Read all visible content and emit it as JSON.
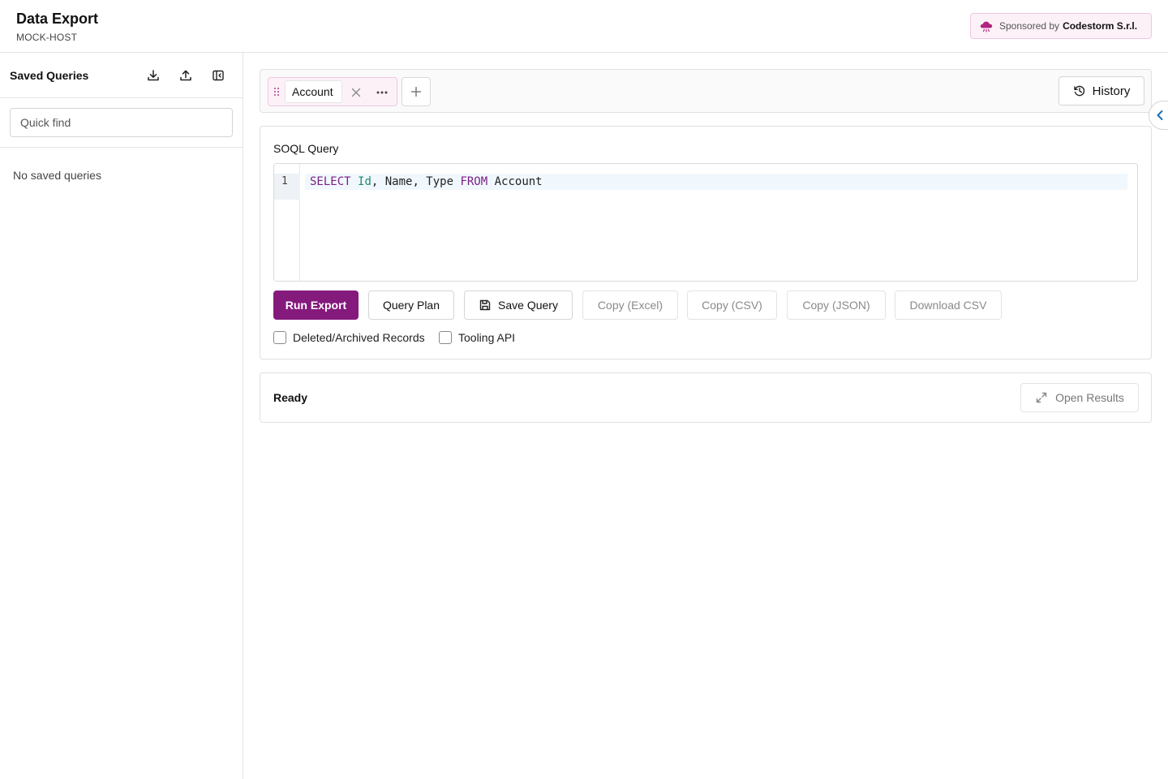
{
  "header": {
    "title": "Data Export",
    "host": "MOCK-HOST",
    "sponsor_prefix": "Sponsored by",
    "sponsor_name": "Codestorm S.r.l.",
    "sponsor_icon": "cloud-icon"
  },
  "sidebar": {
    "title": "Saved Queries",
    "icons": [
      "download-icon",
      "upload-icon",
      "collapse-sidebar-icon"
    ],
    "search_placeholder": "Quick find",
    "empty_text": "No saved queries"
  },
  "tabs": {
    "items": [
      {
        "label": "Account",
        "active": true
      }
    ],
    "history_label": "History"
  },
  "query": {
    "section_title": "SOQL Query",
    "line_number": "1",
    "code": {
      "select": "SELECT",
      "field_id": "Id",
      "rest": ", Name, Type ",
      "from": "FROM",
      "object": " Account"
    }
  },
  "actions": {
    "run_export": "Run Export",
    "query_plan": "Query Plan",
    "save_query": "Save Query",
    "copy_excel": "Copy (Excel)",
    "copy_csv": "Copy (CSV)",
    "copy_json": "Copy (JSON)",
    "download_csv": "Download CSV"
  },
  "options": {
    "deleted_archived": {
      "label": "Deleted/Archived Records",
      "checked": false
    },
    "tooling_api": {
      "label": "Tooling API",
      "checked": false
    }
  },
  "status": {
    "text": "Ready",
    "open_results": "Open Results"
  },
  "colors": {
    "accent": "#851a7d",
    "sponsor_bg": "#fdf1f8",
    "keyword": "#7a1f83",
    "field": "#1f8a6f"
  }
}
